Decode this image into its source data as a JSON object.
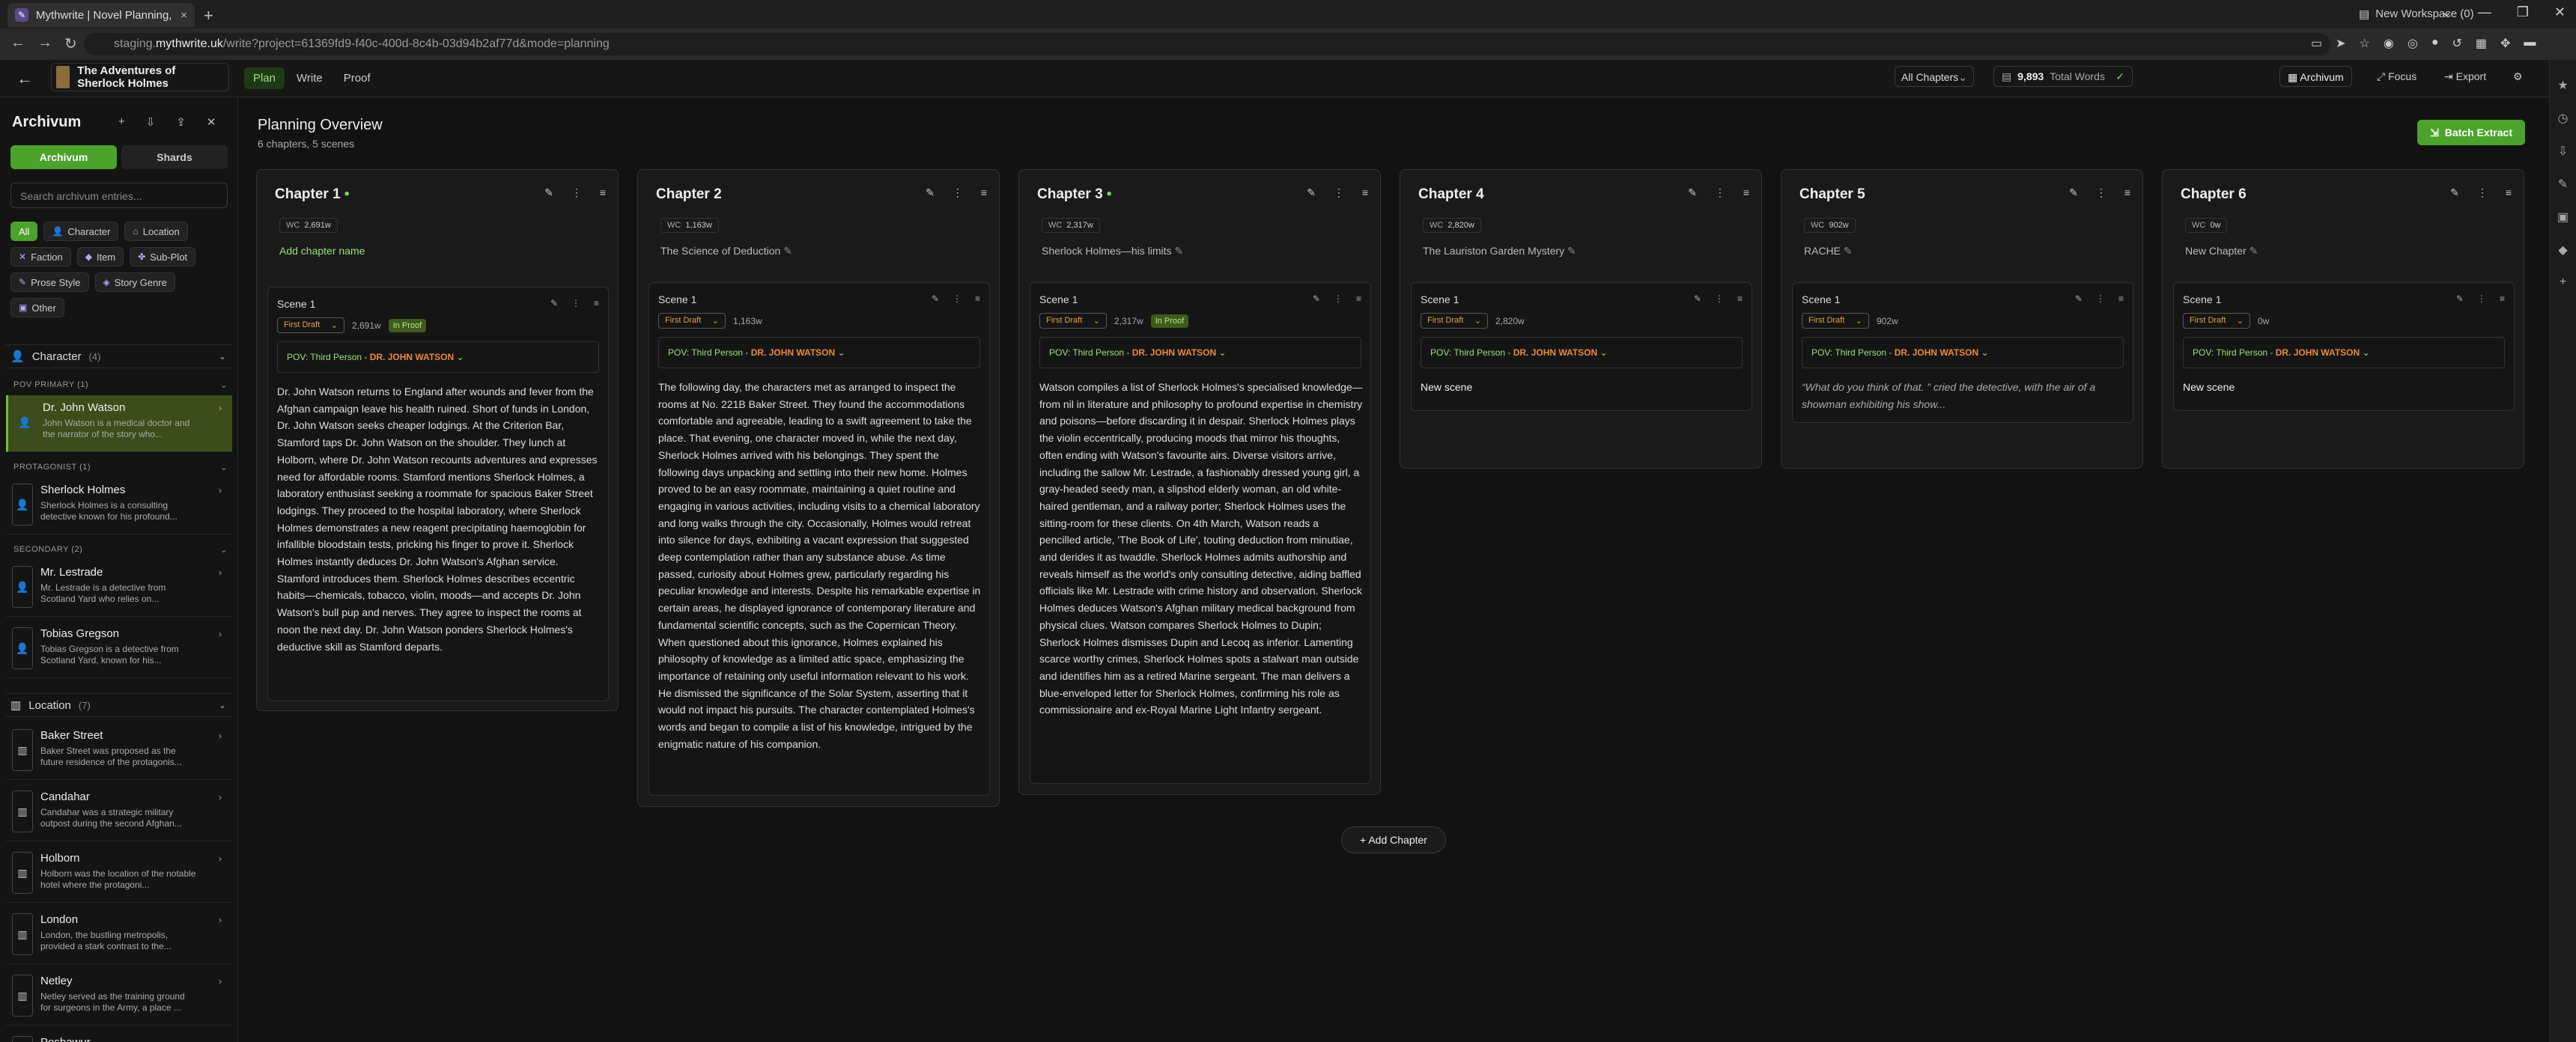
{
  "browser": {
    "tab_title": "Mythwrite | Novel Planning, Wr",
    "tab_close": "×",
    "new_tab": "+",
    "workspace": "New Workspace (0)",
    "url_prefix": "staging.",
    "url_domain": "mythwrite.uk",
    "url_path": "/write?project=61369fd9-f40c-400d-8c4b-03d94b2af77d&mode=planning",
    "min_label": "—",
    "max_label": "❐",
    "close_label": "✕"
  },
  "header": {
    "back_label": "←",
    "book_title": "The Adventures of Sherlock Holmes",
    "modes": [
      {
        "label": "Plan",
        "active": true
      },
      {
        "label": "Write",
        "active": false
      },
      {
        "label": "Proof",
        "active": false
      }
    ],
    "chapter_select": "All Chapters",
    "word_count": "9,893",
    "word_count_label": "Total Words",
    "word_ok": "✓",
    "archivum_label": "Archivum",
    "focus_label": "Focus",
    "export_label": "Export",
    "settings_icon": "⚙"
  },
  "sidebar": {
    "title": "Archivum",
    "tabs": [
      {
        "label": "Archivum",
        "active": true
      },
      {
        "label": "Shards",
        "active": false
      }
    ],
    "search_placeholder": "Search archivum entries...",
    "chips": [
      {
        "label": "All",
        "icon": "",
        "active": true
      },
      {
        "label": "Character",
        "icon": "👤",
        "active": false
      },
      {
        "label": "Location",
        "icon": "⌂",
        "active": false
      },
      {
        "label": "Faction",
        "icon": "✕",
        "active": false
      },
      {
        "label": "Item",
        "icon": "◆",
        "active": false
      },
      {
        "label": "Sub-Plot",
        "icon": "✤",
        "active": false
      },
      {
        "label": "Prose Style",
        "icon": "✎",
        "active": false
      },
      {
        "label": "Story Genre",
        "icon": "◈",
        "active": false
      },
      {
        "label": "Other",
        "icon": "▣",
        "active": false
      }
    ],
    "character_section": {
      "label": "Character",
      "count": "(4)"
    },
    "pov_primary": {
      "label": "POV PRIMARY (1)"
    },
    "protagonist": {
      "label": "PROTAGONIST (1)"
    },
    "secondary": {
      "label": "SECONDARY (2)"
    },
    "characters": [
      {
        "name": "Dr. John Watson",
        "desc": "John Watson is a medical doctor and the narrator of the story who..."
      },
      {
        "name": "Sherlock Holmes",
        "desc": "Sherlock Holmes is a consulting detective known for his profound..."
      },
      {
        "name": "Mr. Lestrade",
        "desc": "Mr. Lestrade is a detective from Scotland Yard who relies on..."
      },
      {
        "name": "Tobias Gregson",
        "desc": "Tobias Gregson is a detective from Scotland Yard, known for his..."
      }
    ],
    "location_section": {
      "label": "Location",
      "count": "(7)"
    },
    "locations": [
      {
        "name": "Baker Street",
        "desc": "Baker Street was proposed as the future residence of the protagonis..."
      },
      {
        "name": "Candahar",
        "desc": "Candahar was a strategic military outpost during the second Afghan..."
      },
      {
        "name": "Holborn",
        "desc": "Holborn was the location of the notable hotel where the protagoni..."
      },
      {
        "name": "London",
        "desc": "London, the bustling metropolis, provided a stark contrast to the..."
      },
      {
        "name": "Netley",
        "desc": "Netley served as the training ground for surgeons in the Army, a place ..."
      },
      {
        "name": "Peshawur",
        "desc": ""
      }
    ]
  },
  "main": {
    "title": "Planning Overview",
    "subtitle": "6 chapters, 5 scenes",
    "batch_label": "Batch Extract",
    "add_chapter": "+ Add Chapter",
    "pov_prefix": "POV: Third Person - ",
    "pov_name": "DR. JOHN WATSON",
    "chapters": [
      {
        "name": "Chapter 1",
        "dot": "•",
        "wc_label": "WC",
        "wc": "2,691w",
        "subtitle": "Add chapter name",
        "scene_title": "Scene 1",
        "draft": "First Draft",
        "scene_wc": "2,691w",
        "status": "In Proof",
        "synopsis": "Dr. John Watson returns to England after wounds and fever from the Afghan campaign leave his health ruined. Short of funds in London, Dr. John Watson seeks cheaper lodgings. At the Criterion Bar, Stamford taps Dr. John Watson on the shoulder. They lunch at Holborn, where Dr. John Watson recounts adventures and expresses need for affordable rooms. Stamford mentions Sherlock Holmes, a laboratory enthusiast seeking a roommate for spacious Baker Street lodgings. They proceed to the hospital laboratory, where Sherlock Holmes demonstrates a new reagent precipitating haemoglobin for infallible bloodstain tests, pricking his finger to prove it. Sherlock Holmes instantly deduces Dr. John Watson's Afghan service. Stamford introduces them. Sherlock Holmes describes eccentric habits—chemicals, tobacco, violin, moods—and accepts Dr. John Watson's bull pup and nerves. They agree to inspect the rooms at noon the next day. Dr. John Watson ponders Sherlock Holmes's deductive skill as Stamford departs."
      },
      {
        "name": "Chapter 2",
        "dot": "",
        "wc_label": "WC",
        "wc": "1,163w",
        "subtitle": "The Science of Deduction",
        "scene_title": "Scene 1",
        "draft": "First Draft",
        "scene_wc": "1,163w",
        "status": "",
        "synopsis": "The following day, the characters met as arranged to inspect the rooms at No. 221B Baker Street. They found the accommodations comfortable and agreeable, leading to a swift agreement to take the place. That evening, one character moved in, while the next day, Sherlock Holmes arrived with his belongings. They spent the following days unpacking and settling into their new home. Holmes proved to be an easy roommate, maintaining a quiet routine and engaging in various activities, including visits to a chemical laboratory and long walks through the city. Occasionally, Holmes would retreat into silence for days, exhibiting a vacant expression that suggested deep contemplation rather than any substance abuse. As time passed, curiosity about Holmes grew, particularly regarding his peculiar knowledge and interests. Despite his remarkable expertise in certain areas, he displayed ignorance of contemporary literature and fundamental scientific concepts, such as the Copernican Theory. When questioned about this ignorance, Holmes explained his philosophy of knowledge as a limited attic space, emphasizing the importance of retaining only useful information relevant to his work. He dismissed the significance of the Solar System, asserting that it would not impact his pursuits. The character contemplated Holmes's words and began to compile a list of his knowledge, intrigued by the enigmatic nature of his companion."
      },
      {
        "name": "Chapter 3",
        "dot": "•",
        "wc_label": "WC",
        "wc": "2,317w",
        "subtitle": "Sherlock Holmes—his limits",
        "scene_title": "Scene 1",
        "draft": "First Draft",
        "scene_wc": "2,317w",
        "status": "In Proof",
        "synopsis": "Watson compiles a list of Sherlock Holmes's specialised knowledge—from nil in literature and philosophy to profound expertise in chemistry and poisons—before discarding it in despair. Sherlock Holmes plays the violin eccentrically, producing moods that mirror his thoughts, often ending with Watson's favourite airs. Diverse visitors arrive, including the sallow Mr. Lestrade, a fashionably dressed young girl, a gray-headed seedy man, a slipshod elderly woman, an old white-haired gentleman, and a railway porter; Sherlock Holmes uses the sitting-room for these clients. On 4th March, Watson reads a pencilled article, 'The Book of Life', touting deduction from minutiae, and derides it as twaddle. Sherlock Holmes admits authorship and reveals himself as the world's only consulting detective, aiding baffled officials like Mr. Lestrade with crime history and observation. Sherlock Holmes deduces Watson's Afghan military medical background from physical clues. Watson compares Sherlock Holmes to Dupin; Sherlock Holmes dismisses Dupin and Lecoq as inferior. Lamenting scarce worthy crimes, Sherlock Holmes spots a stalwart man outside and identifies him as a retired Marine sergeant. The man delivers a blue-enveloped letter for Sherlock Holmes, confirming his role as commissionaire and ex-Royal Marine Light Infantry sergeant."
      },
      {
        "name": "Chapter 4",
        "dot": "",
        "wc_label": "WC",
        "wc": "2,820w",
        "subtitle": "The Lauriston Garden Mystery",
        "scene_title": "Scene 1",
        "draft": "First Draft",
        "scene_wc": "2,820w",
        "status": "",
        "synopsis": "New scene"
      },
      {
        "name": "Chapter 5",
        "dot": "",
        "wc_label": "WC",
        "wc": "902w",
        "subtitle": "RACHE",
        "scene_title": "Scene 1",
        "draft": "First Draft",
        "scene_wc": "902w",
        "status": "",
        "synopsis": "“What do you think of that. ” cried the detective, with the air of a showman exhibiting his show..."
      },
      {
        "name": "Chapter 6",
        "dot": "",
        "wc_label": "WC",
        "wc": "0w",
        "subtitle": "New Chapter",
        "scene_title": "Scene 1",
        "draft": "First Draft",
        "scene_wc": "0w",
        "status": "",
        "synopsis": "New scene"
      }
    ]
  }
}
